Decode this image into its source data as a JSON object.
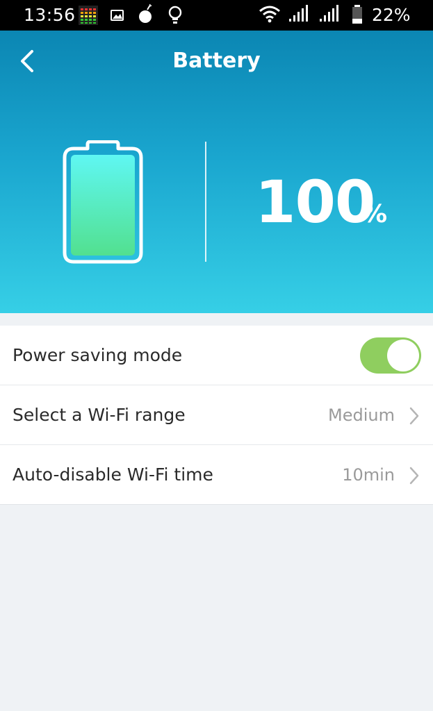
{
  "status_bar": {
    "time": "13:56",
    "battery_percent": "22%",
    "icons": [
      "equalizer-app-icon",
      "image-icon",
      "bomb-icon",
      "lightbulb-icon",
      "wifi-icon",
      "signal-icon",
      "signal-icon",
      "battery-icon"
    ]
  },
  "header": {
    "title": "Battery",
    "back_icon": "back-arrow-icon"
  },
  "battery": {
    "level": "100",
    "unit": "%",
    "fill_fraction": 1.0,
    "colors": {
      "fill_top": "#5ff7f3",
      "fill_bottom": "#52e08f"
    }
  },
  "settings": [
    {
      "label": "Power saving mode",
      "type": "toggle",
      "on": true,
      "toggle_color": "#8fce5f"
    },
    {
      "label": "Select a Wi-Fi range",
      "type": "select",
      "value": "Medium"
    },
    {
      "label": "Auto-disable Wi-Fi time",
      "type": "select",
      "value": "10min"
    }
  ]
}
